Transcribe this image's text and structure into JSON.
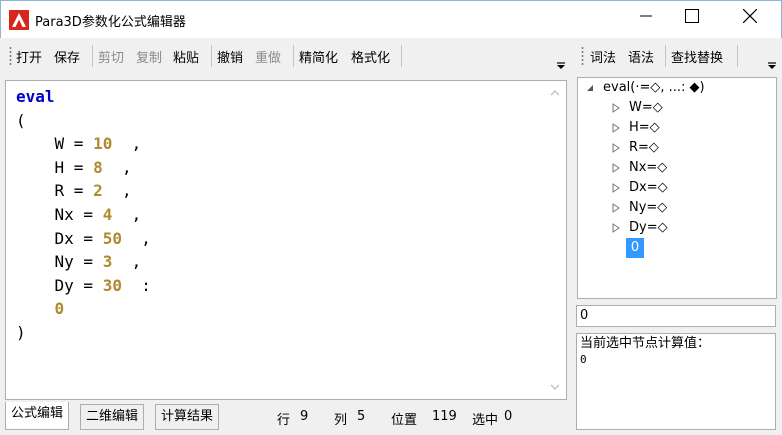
{
  "window": {
    "title": "Para3D参数化公式编辑器"
  },
  "toolbar_left": {
    "open": "打开",
    "save": "保存",
    "cut": "剪切",
    "copy": "复制",
    "paste": "粘贴",
    "undo": "撤销",
    "redo": "重做",
    "simplify": "精简化",
    "format": "格式化"
  },
  "toolbar_right": {
    "lexical": "词法",
    "syntax": "语法",
    "find_replace": "查找替换"
  },
  "editor": {
    "keyword": "eval",
    "open_paren": "(",
    "close_paren": ")",
    "params": [
      {
        "name": "W",
        "value": "10",
        "sep": ","
      },
      {
        "name": "H",
        "value": "8",
        "sep": ","
      },
      {
        "name": "R",
        "value": "2",
        "sep": ","
      },
      {
        "name": "Nx",
        "value": "4",
        "sep": ","
      },
      {
        "name": "Dx",
        "value": "50",
        "sep": ","
      },
      {
        "name": "Ny",
        "value": "3",
        "sep": ","
      },
      {
        "name": "Dy",
        "value": "30",
        "sep": ":"
      }
    ],
    "body": "0"
  },
  "tabs": {
    "formula_edit": "公式编辑",
    "two_d_edit": "二维编辑",
    "calc_result": "计算结果"
  },
  "status": {
    "row_label": "行",
    "row_value": "9",
    "col_label": "列",
    "col_value": "5",
    "pos_label": "位置",
    "pos_value": "119",
    "sel_label": "选中",
    "sel_value": "0"
  },
  "tree": {
    "root": "eval(·=◇, ...: ◆)",
    "children": [
      "W=◇",
      "H=◇",
      "R=◇",
      "Nx=◇",
      "Dx=◇",
      "Ny=◇",
      "Dy=◇"
    ],
    "selected": "0"
  },
  "value_box": "0",
  "result": {
    "title": "当前选中节点计算值：",
    "value": "0"
  },
  "colors": {
    "keyword": "#0000c8",
    "number": "#b08a2e",
    "selection": "#3399ff",
    "app_icon": "#d9261c"
  }
}
